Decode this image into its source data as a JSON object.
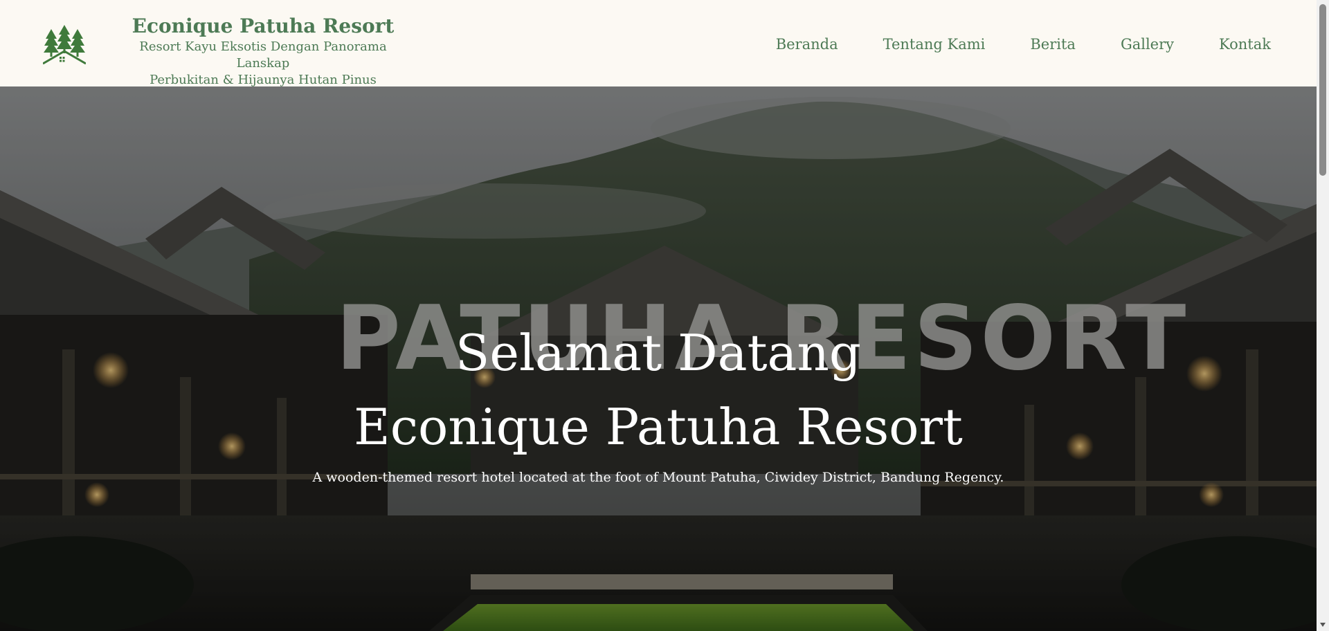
{
  "site": {
    "name": "Econique Patuha Resort",
    "tagline_line1": "Resort Kayu Eksotis Dengan Panorama Lanskap",
    "tagline_line2": "Perbukitan & Hijaunya Hutan Pinus",
    "logo_icon": "pine-trees-house-icon"
  },
  "nav": {
    "items": [
      {
        "label": "Beranda"
      },
      {
        "label": "Tentang Kami"
      },
      {
        "label": "Berita"
      },
      {
        "label": "Gallery"
      },
      {
        "label": "Kontak"
      }
    ]
  },
  "hero": {
    "sign_text": "PATUHA RESORT",
    "title_line1": "Selamat Datang",
    "title_line2": "Econique Patuha Resort",
    "subtitle": "A wooden-themed resort hotel located at the foot of Mount Patuha, Ciwidey District, Bandung Regency."
  },
  "colors": {
    "brand_green": "#4d7a55",
    "header_bg": "#fcf9f3",
    "hero_text": "#ffffff"
  }
}
